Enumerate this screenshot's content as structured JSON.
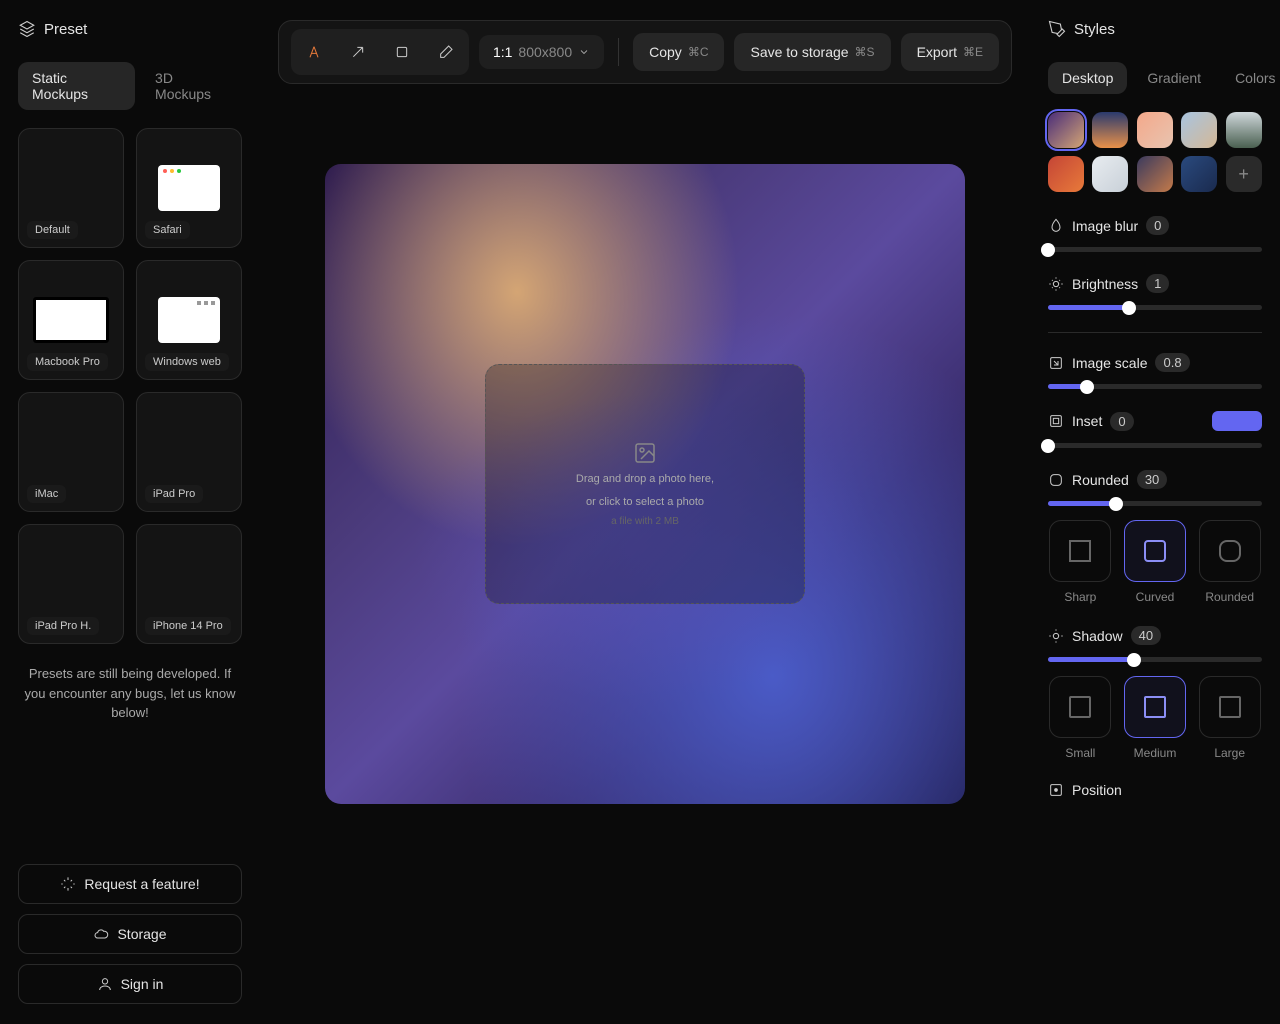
{
  "left": {
    "title": "Preset",
    "tabs": {
      "static": "Static Mockups",
      "threeD": "3D Mockups"
    },
    "presets": [
      {
        "label": "Default"
      },
      {
        "label": "Safari"
      },
      {
        "label": "Macbook Pro"
      },
      {
        "label": "Windows web"
      },
      {
        "label": "iMac"
      },
      {
        "label": "iPad Pro"
      },
      {
        "label": "iPad Pro H."
      },
      {
        "label": "iPhone 14 Pro"
      }
    ],
    "dev_note": "Presets are still being developed. If you encounter any bugs, let us know below!",
    "footer": {
      "feature": "Request a feature!",
      "storage": "Storage",
      "signin": "Sign in"
    }
  },
  "toolbar": {
    "ratio": "1:1",
    "dimensions": "800x800",
    "copy": "Copy",
    "copy_sc": "⌘C",
    "save": "Save to storage",
    "save_sc": "⌘S",
    "export": "Export",
    "export_sc": "⌘E"
  },
  "dropzone": {
    "line1": "Drag and drop a photo here,",
    "line2": "or click to select a photo",
    "line3": "a file with 2 MB"
  },
  "right": {
    "title": "Styles",
    "tabs": {
      "desktop": "Desktop",
      "gradient": "Gradient",
      "colors": "Colors"
    },
    "swatches": [
      "linear-gradient(135deg,#4a2d7a,#d4a574)",
      "linear-gradient(180deg,#2a3a6e,#e8914a)",
      "linear-gradient(135deg,#f4a88a,#e8c4b0)",
      "linear-gradient(135deg,#a8c4e0,#d4b896)",
      "linear-gradient(180deg,#d0d8dc,#4a6050)",
      "linear-gradient(135deg,#c44536,#e87a3a)",
      "linear-gradient(135deg,#e8ecf0,#c8d0d8)",
      "linear-gradient(135deg,#3a3a5e,#c47a4a)",
      "linear-gradient(135deg,#2a4a7e,#1a2a4e)"
    ],
    "blur": {
      "label": "Image blur",
      "value": "0",
      "pct": 0
    },
    "brightness": {
      "label": "Brightness",
      "value": "1",
      "pct": 38
    },
    "scale": {
      "label": "Image scale",
      "value": "0.8",
      "pct": 18
    },
    "inset": {
      "label": "Inset",
      "value": "0",
      "pct": 0,
      "color": "#6366f1"
    },
    "rounded": {
      "label": "Rounded",
      "value": "30",
      "pct": 32,
      "opts": {
        "sharp": "Sharp",
        "curved": "Curved",
        "round": "Rounded"
      }
    },
    "shadow": {
      "label": "Shadow",
      "value": "40",
      "pct": 40,
      "opts": {
        "small": "Small",
        "medium": "Medium",
        "large": "Large"
      }
    },
    "position": {
      "label": "Position"
    }
  }
}
